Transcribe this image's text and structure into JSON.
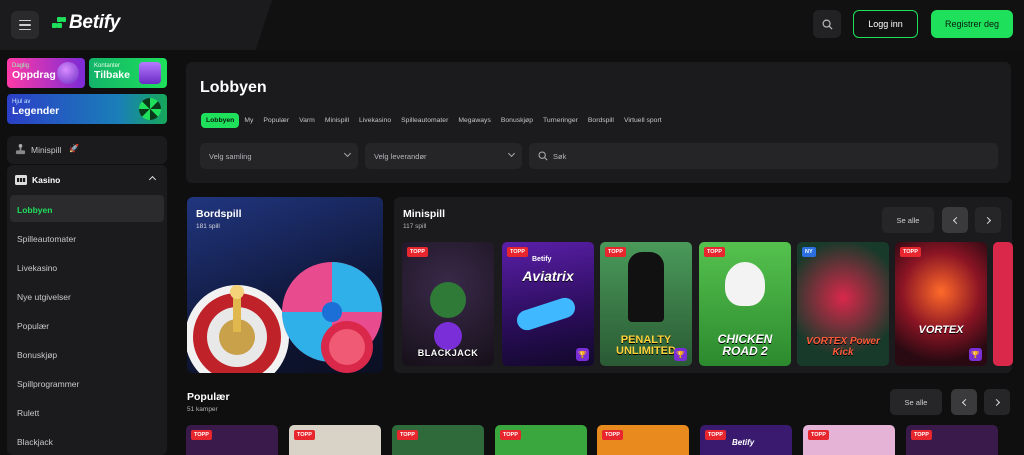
{
  "header": {
    "logo_text": "Betify",
    "login_label": "Logg inn",
    "register_label": "Registrer deg",
    "accent_color": "#1ee05a"
  },
  "sidebar": {
    "promos": [
      {
        "small": "Daglig",
        "big": "Oppdrag"
      },
      {
        "small": "Kontanter",
        "big": "Tilbake"
      },
      {
        "small": "Hjul av",
        "big": "Legender"
      }
    ],
    "minispill_label": "Minispill",
    "kasino_label": "Kasino",
    "items": [
      "Lobbyen",
      "Spilleautomater",
      "Livekasino",
      "Nye utgivelser",
      "Populær",
      "Bonuskjøp",
      "Spillprogrammer",
      "Rulett",
      "Blackjack"
    ],
    "active_item": "Lobbyen"
  },
  "lobby": {
    "title": "Lobbyen",
    "filters": [
      "Lobbyen",
      "My",
      "Populær",
      "Varm",
      "Minispill",
      "Livekasino",
      "Spilleautomater",
      "Megaways",
      "Bonuskjøp",
      "Turneringer",
      "Bordspill",
      "Virtuell sport"
    ],
    "active_filter": "Lobbyen",
    "collection_placeholder": "Velg samling",
    "provider_placeholder": "Velg leverandør",
    "search_placeholder": "Søk"
  },
  "bordspill": {
    "title": "Bordspill",
    "count": "181 spill"
  },
  "minispill": {
    "title": "Minispill",
    "count": "117 spill",
    "see_all": "Se alle",
    "games": [
      {
        "badge": "TOPP",
        "name": "BLACKJACK",
        "bg": "#241b2e"
      },
      {
        "badge": "TOPP",
        "name": "Aviatrix",
        "bg": "#3a1a6e",
        "top_text": "Betify"
      },
      {
        "badge": "TOPP",
        "name": "PENALTY UNLIMITED",
        "bg": "#2a6a3a"
      },
      {
        "badge": "TOPP",
        "name": "CHICKEN ROAD 2",
        "bg": "#3aa63e"
      },
      {
        "badge": "NY",
        "name": "VORTEX Power Kick",
        "bg": "#173a2a"
      },
      {
        "badge": "TOPP",
        "name": "VORTEX",
        "bg": "#5a1020"
      }
    ]
  },
  "popular": {
    "title": "Populær",
    "count": "51 kamper",
    "see_all": "Se alle",
    "tiles": [
      {
        "badge": "TOPP",
        "bg": "#3a1a4a",
        "label": ""
      },
      {
        "badge": "TOPP",
        "bg": "#d9d2c6",
        "label": ""
      },
      {
        "badge": "TOPP",
        "bg": "#2f6a3a",
        "label": ""
      },
      {
        "badge": "TOPP",
        "bg": "#3aa63e",
        "label": ""
      },
      {
        "badge": "TOPP",
        "bg": "#e98a1e",
        "label": ""
      },
      {
        "badge": "TOPP",
        "bg": "#3a1a6e",
        "label": "Betify"
      },
      {
        "badge": "TOPP",
        "bg": "#e4b3d6",
        "label": ""
      },
      {
        "badge": "TOPP",
        "bg": "#3a1a4a",
        "label": ""
      }
    ]
  }
}
